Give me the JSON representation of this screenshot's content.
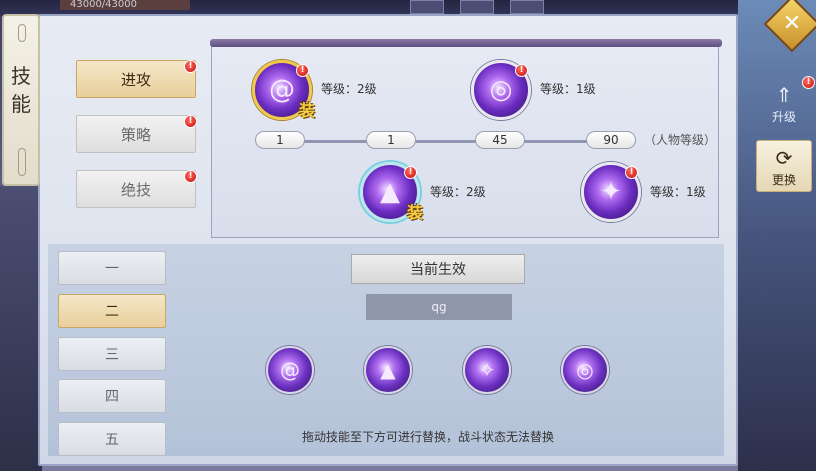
{
  "hud": {
    "hp_text": "43000/43000"
  },
  "title": "技能",
  "categories": [
    {
      "label": "进攻",
      "active": true
    },
    {
      "label": "策略",
      "active": false
    },
    {
      "label": "绝技",
      "active": false
    }
  ],
  "skills": {
    "top_left": {
      "level": "等级：2级",
      "equipped_badge": "装",
      "icon": "swirl-skill-icon"
    },
    "top_right": {
      "level": "等级：1级",
      "icon": "vortex-skill-icon"
    },
    "bottom_left": {
      "level": "等级：2级",
      "equipped_badge": "装",
      "icon": "spikes-skill-icon"
    },
    "bottom_right": {
      "level": "等级：1级",
      "icon": "slash-skill-icon"
    }
  },
  "progress": {
    "values": [
      "1",
      "1",
      "45",
      "90"
    ],
    "suffix": "（人物等级）"
  },
  "slots": [
    {
      "label": "一",
      "active": false
    },
    {
      "label": "二",
      "active": true
    },
    {
      "label": "三",
      "active": false
    },
    {
      "label": "四",
      "active": false
    },
    {
      "label": "五",
      "active": false
    }
  ],
  "current": {
    "button_label": "当前生效",
    "name_value": "qg"
  },
  "bottom_icons": [
    "swirl-skill-icon",
    "spike-skill-icon",
    "claw-skill-icon",
    "vortex-skill-icon"
  ],
  "hint": "拖动技能至下方可进行替换，战斗状态无法替换",
  "side_tabs": [
    {
      "label": "升级",
      "active": false
    },
    {
      "label": "更换",
      "active": true
    }
  ],
  "red_dot_mark": "!"
}
